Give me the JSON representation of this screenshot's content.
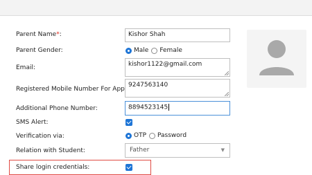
{
  "form": {
    "parent_name": {
      "label": "Parent Name",
      "required_mark": "*",
      "value": "Kishor Shah"
    },
    "parent_gender": {
      "label": "Parent Gender:",
      "options": [
        "Male",
        "Female"
      ],
      "selected": "Male"
    },
    "email": {
      "label": "Email:",
      "value": "kishor1122@gmail.com"
    },
    "mobile": {
      "label": "Registered Mobile Number For App",
      "required_mark": "*",
      "value": "9247563140"
    },
    "additional_phone": {
      "label": "Additional Phone Number:",
      "value": "8894523145"
    },
    "sms_alert": {
      "label": "SMS Alert:",
      "checked": true
    },
    "verification": {
      "label": "Verification via:",
      "options": [
        "OTP",
        "Password"
      ],
      "selected": "OTP"
    },
    "relation": {
      "label": "Relation with Student:",
      "value": "Father",
      "arrow": "▼"
    },
    "share_login": {
      "label": "Share login credentials:",
      "checked": true
    }
  },
  "colors": {
    "accent": "#1e75d6",
    "required": "#e0291d",
    "highlight": "#e04a43"
  },
  "icons": {
    "avatar": "user-placeholder-icon"
  }
}
